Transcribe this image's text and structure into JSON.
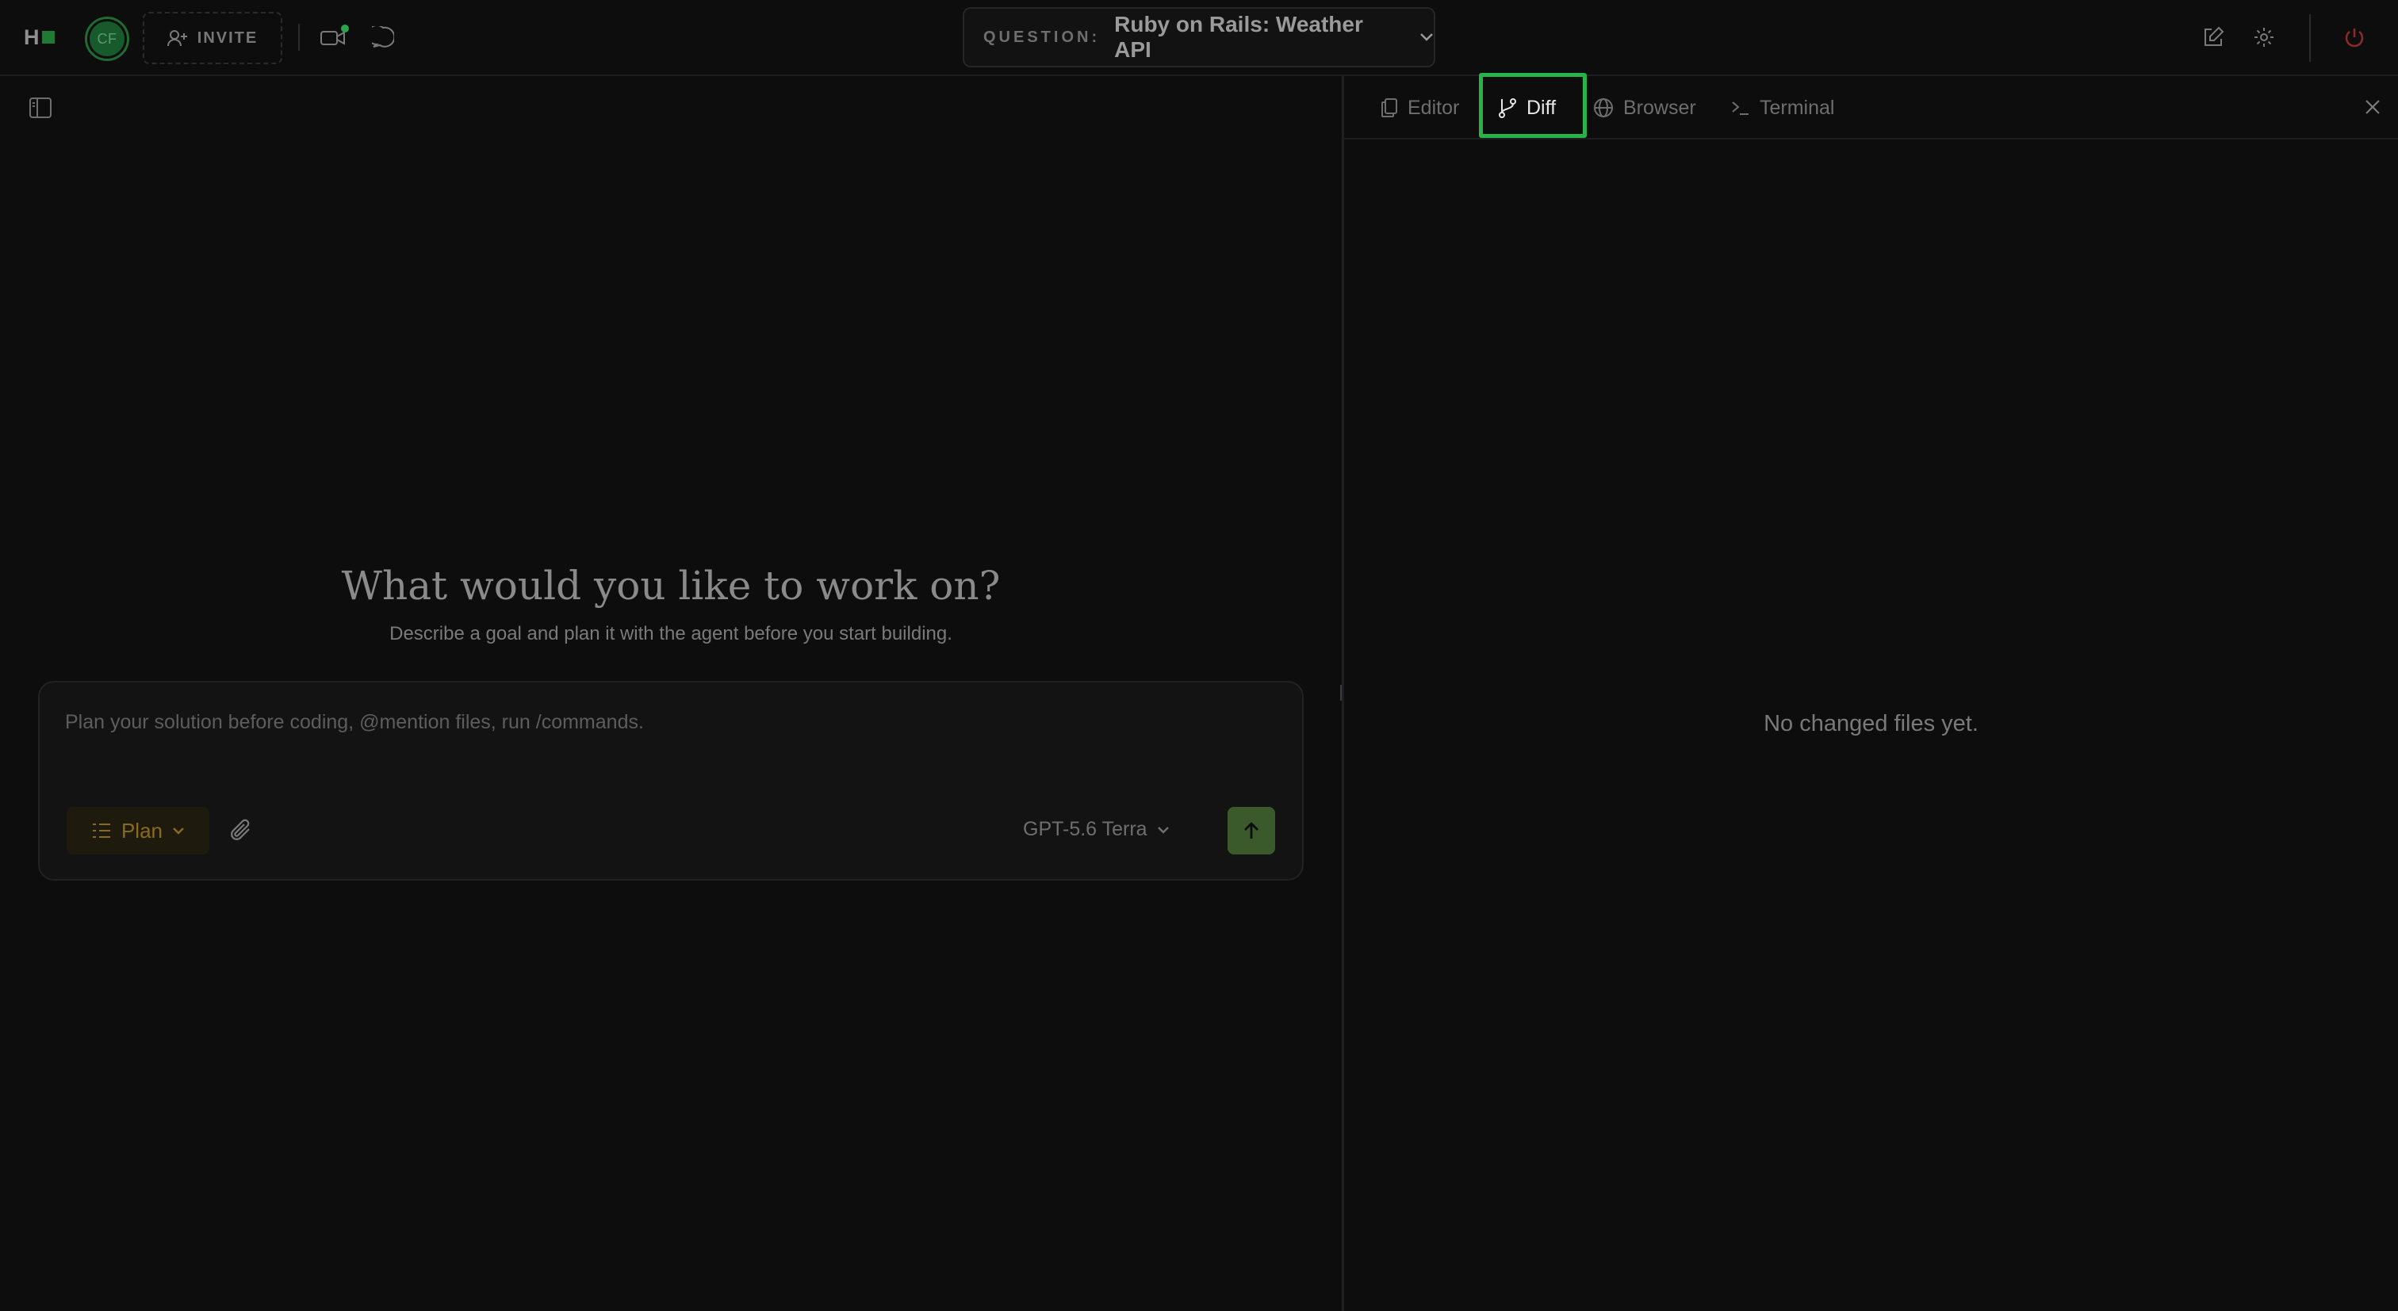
{
  "topbar": {
    "logo_letter": "H",
    "avatar_initials": "CF",
    "invite_label": "INVITE",
    "question_label": "QUESTION:",
    "question_title": "Ruby on Rails: Weather API"
  },
  "left_panel": {
    "hero_title": "What would you like to work on?",
    "hero_subtitle": "Describe a goal and plan it with the agent before you start building.",
    "composer": {
      "placeholder": "Plan your solution before coding, @mention files, run /commands.",
      "mode_label": "Plan",
      "model_label": "GPT-5.6 Terra"
    }
  },
  "right_panel": {
    "tabs": [
      {
        "label": "Editor",
        "icon": "files-icon",
        "active": false
      },
      {
        "label": "Diff",
        "icon": "git-branch-icon",
        "active": true
      },
      {
        "label": "Browser",
        "icon": "globe-icon",
        "active": false
      },
      {
        "label": "Terminal",
        "icon": "terminal-icon",
        "active": false
      }
    ],
    "empty_message": "No changed files yet."
  },
  "colors": {
    "background": "#0d0d0e",
    "accent_green": "#27b24a",
    "plan_amber": "#8a6a1e",
    "power_red": "#8a2a2a"
  }
}
